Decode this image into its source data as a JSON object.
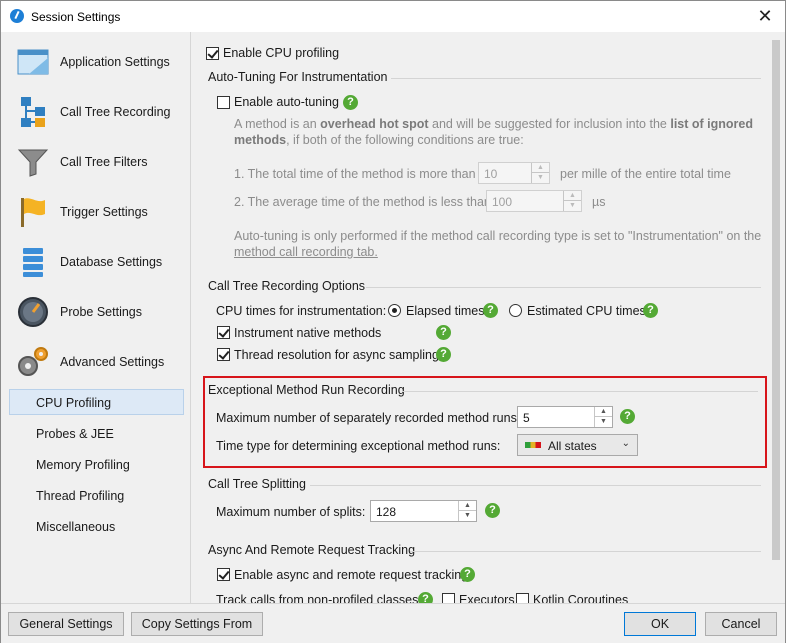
{
  "window": {
    "title": "Session Settings",
    "close": "✕"
  },
  "sidebar": {
    "items": [
      {
        "label": "Application Settings",
        "icon": "application-settings-icon"
      },
      {
        "label": "Call Tree Recording",
        "icon": "call-tree-recording-icon"
      },
      {
        "label": "Call Tree Filters",
        "icon": "funnel-icon"
      },
      {
        "label": "Trigger Settings",
        "icon": "flag-icon"
      },
      {
        "label": "Database Settings",
        "icon": "database-icon"
      },
      {
        "label": "Probe Settings",
        "icon": "gauge-icon"
      },
      {
        "label": "Advanced Settings",
        "icon": "gears-icon"
      }
    ],
    "subitems": [
      {
        "label": "CPU Profiling",
        "selected": true
      },
      {
        "label": "Probes & JEE",
        "selected": false
      },
      {
        "label": "Memory Profiling",
        "selected": false
      },
      {
        "label": "Thread Profiling",
        "selected": false
      },
      {
        "label": "Miscellaneous",
        "selected": false
      }
    ]
  },
  "main": {
    "enable_cpu_profiling": {
      "label": "Enable CPU profiling",
      "checked": true
    },
    "auto_tuning": {
      "heading": "Auto-Tuning For Instrumentation",
      "enable_label": "Enable auto-tuning",
      "enabled": false,
      "desc_1a": "A method is an ",
      "desc_1b": "overhead hot spot",
      "desc_1c": " and will be suggested for inclusion into the ",
      "desc_1d": "list of ignored",
      "desc_2a": "methods",
      "desc_2b": ", if both of the following conditions are true:",
      "cond1_label": "1. The total time of the method is more than",
      "cond1_value": "10",
      "cond1_unit": "per mille of the entire total time",
      "cond2_label": "2. The average time of the method is less than",
      "cond2_value": "100",
      "cond2_unit": "µs",
      "note_1": "Auto-tuning is only performed if the method call recording type is set to \"Instrumentation\" on the",
      "note_2": "method call recording tab."
    },
    "call_tree_recording": {
      "heading": "Call Tree Recording Options",
      "cpu_times_label": "CPU times for instrumentation:",
      "elapsed_label": "Elapsed times",
      "elapsed_selected": true,
      "estimated_label": "Estimated CPU times",
      "instrument_native_label": "Instrument native methods",
      "instrument_native_checked": true,
      "thread_resolution_label": "Thread resolution for async sampling",
      "thread_resolution_checked": true
    },
    "exceptional": {
      "heading": "Exceptional Method Run Recording",
      "max_runs_label": "Maximum number of separately recorded method runs:",
      "max_runs_value": "5",
      "time_type_label": "Time type for determining exceptional method runs:",
      "time_type_value": "All states"
    },
    "splitting": {
      "heading": "Call Tree Splitting",
      "max_splits_label": "Maximum number of splits:",
      "max_splits_value": "128"
    },
    "async": {
      "heading": "Async And Remote Request Tracking",
      "enable_label": "Enable async and remote request tracking",
      "enable_checked": true,
      "track_label": "Track calls from non-profiled classes:",
      "executors_label": "Executors",
      "kotlin_label": "Kotlin Coroutines"
    },
    "help_glyph": "?"
  },
  "buttons": {
    "general": "General Settings",
    "copy": "Copy Settings From",
    "ok": "OK",
    "cancel": "Cancel"
  }
}
